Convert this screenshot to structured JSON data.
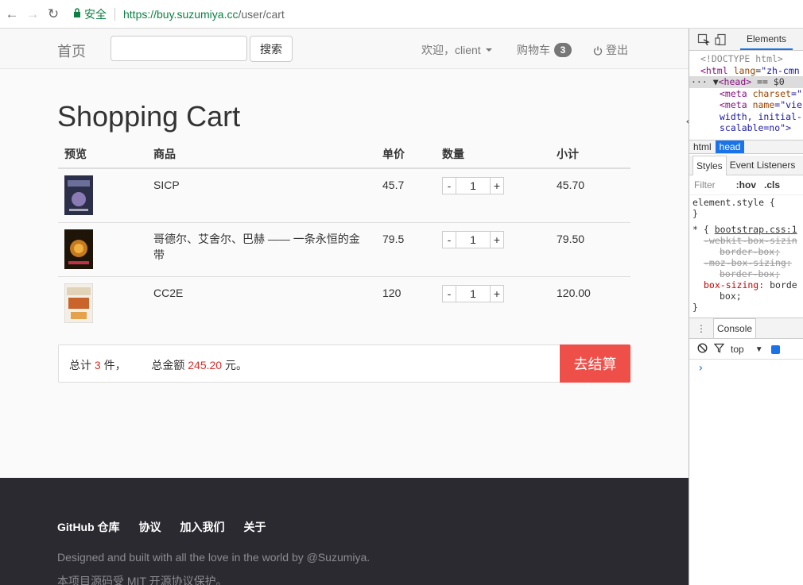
{
  "browser": {
    "secure_label": "安全",
    "url_host": "https://buy.suzumiya.cc",
    "url_path": "/user/cart"
  },
  "navbar": {
    "brand": "首页",
    "search_button": "搜索",
    "welcome": "欢迎，client",
    "cart_label": "购物车",
    "cart_count": "3",
    "logout": "登出"
  },
  "page": {
    "title": "Shopping Cart"
  },
  "table": {
    "headers": [
      "预览",
      "商品",
      "单价",
      "数量",
      "小计"
    ],
    "rows": [
      {
        "name": "SICP",
        "price": "45.7",
        "minus": "-",
        "qty": "1",
        "plus": "+",
        "subtotal": "45.70",
        "cover_color": "#3b3f5e"
      },
      {
        "name": "哥德尔、艾舍尔、巴赫 —— 一条永恒的金带",
        "price": "79.5",
        "minus": "-",
        "qty": "1",
        "plus": "+",
        "subtotal": "79.50",
        "cover_color": "#4a2d12"
      },
      {
        "name": "CC2E",
        "price": "120",
        "minus": "-",
        "qty": "1",
        "plus": "+",
        "subtotal": "120.00",
        "cover_color": "#c9642b"
      }
    ]
  },
  "summary": {
    "total_prefix": "总计",
    "total_count": "3",
    "total_suffix": "件，",
    "amount_prefix": "总金额",
    "amount": "245.20",
    "amount_suffix": "元。",
    "checkout": "去结算"
  },
  "footer": {
    "links": [
      "GitHub 仓库",
      "协议",
      "加入我们",
      "关于"
    ],
    "line1": "Designed and built with all the love in the world by @Suzumiya.",
    "line2": "本项目源码受 MIT 开源协议保护。"
  },
  "devtools": {
    "tab_elements": "Elements",
    "dom": {
      "doctype": "<!DOCTYPE html>",
      "html_open": "<html",
      "html_attr": "lang",
      "html_val": "\"zh-cmn",
      "head_line": "<head>",
      "head_suffix": " == $0",
      "meta1_tag": "<meta",
      "meta1_attr": "charset",
      "meta1_val": "=\"",
      "meta2_tag": "<meta",
      "meta2_attr": "name",
      "meta2_val": "=\"vie",
      "meta2_cont1": "width, initial-",
      "meta2_cont2": "scalable=no\">"
    },
    "crumbs": [
      "html",
      "head"
    ],
    "styles_tab": "Styles",
    "listeners_tab": "Event Listeners",
    "filter": "Filter",
    "hov": ":hov",
    "cls": ".cls",
    "rule1_selector": "element.style {",
    "rule1_close": "}",
    "rule2_selector": "* {",
    "rule2_source": "bootstrap.css:1",
    "rule2_p1": "-webkit-box-sizin",
    "rule2_p1v": "border-box;",
    "rule2_p2": "-moz-box-sizing:",
    "rule2_p2v": "border-box;",
    "rule2_p3": "box-sizing:",
    "rule2_p3v": " borde",
    "rule2_p3v2": "box;",
    "rule2_close": "}",
    "console_tab": "Console",
    "context": "top",
    "prompt": "›"
  }
}
